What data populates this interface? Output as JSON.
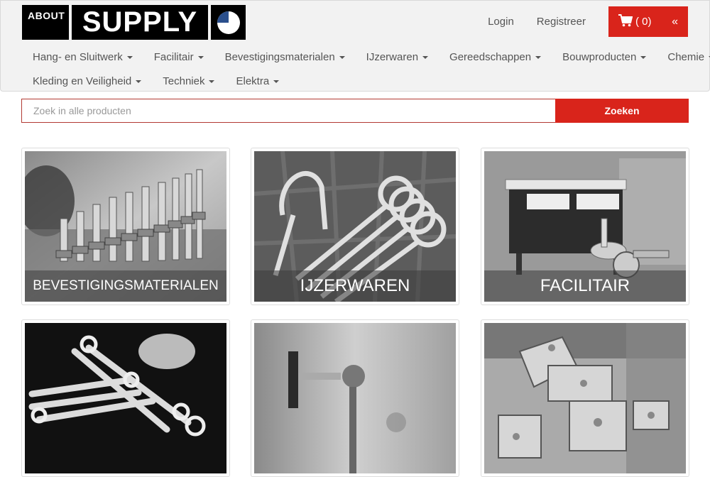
{
  "logo": {
    "about": "ABOUT",
    "supply": "SUPPLY"
  },
  "header": {
    "login": "Login",
    "register": "Registreer",
    "cart_count": "( 0)",
    "collapse": "«"
  },
  "menu": {
    "row1": [
      "Hang- en Sluitwerk",
      "Facilitair",
      "Bevestigingsmaterialen",
      "IJzerwaren",
      "Gereedschappen",
      "Bouwproducten",
      "Chemie"
    ],
    "row2": [
      "Kleding en Veiligheid",
      "Techniek",
      "Elektra"
    ]
  },
  "search": {
    "placeholder": "Zoek in alle producten",
    "button": "Zoeken"
  },
  "tiles": [
    {
      "label": "BEVESTIGINGSMATERIALEN"
    },
    {
      "label": "IJZERWAREN"
    },
    {
      "label": "FACILITAIR"
    },
    {
      "label": ""
    },
    {
      "label": ""
    },
    {
      "label": ""
    }
  ],
  "colors": {
    "accent": "#d9241b",
    "navbar": "#f2f2f2",
    "logo": "#000000"
  },
  "icons": {
    "cart": "shopping-cart-icon",
    "caret": "caret-down-icon"
  }
}
